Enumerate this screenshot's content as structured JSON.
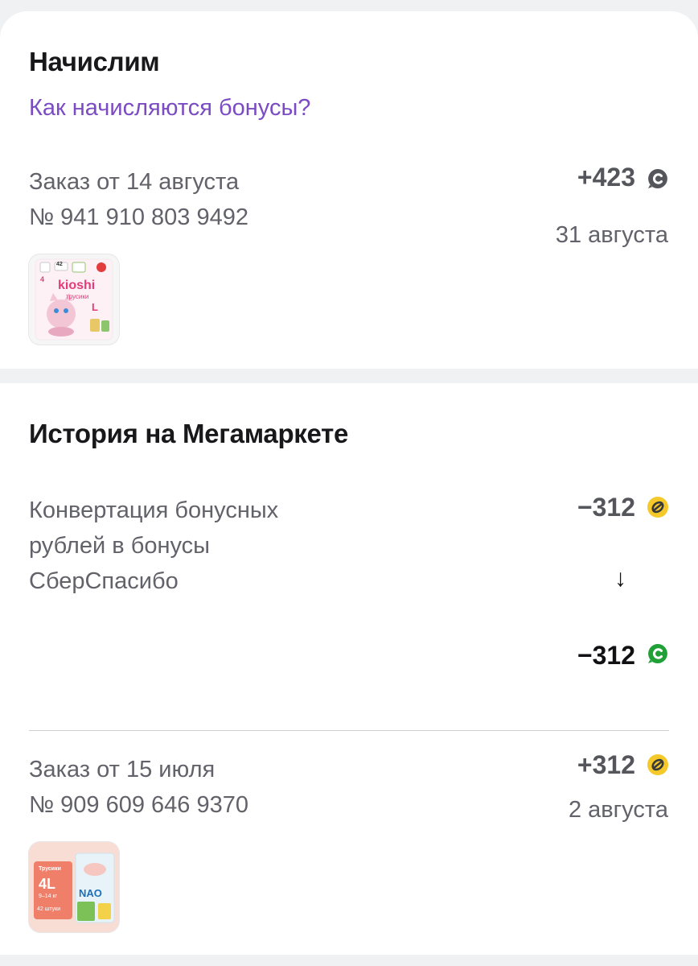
{
  "accrual": {
    "title": "Начислим",
    "how_link": "Как начисляются бонусы?",
    "order": {
      "title": "Заказ от 14 августа",
      "number": "№ 941 910 803 9492",
      "amount": "+423",
      "date": "31 августа",
      "product_label": "kioshi",
      "product_sub": "трусики",
      "product_size": "4",
      "product_count": "42",
      "product_letter": "L",
      "coin_icon": "sberspasibo-coin-grey-icon"
    }
  },
  "history": {
    "title": "История на Мегамаркете",
    "conversion": {
      "title_line1": "Конвертация бонусных",
      "title_line2": "рублей в бонусы",
      "title_line3": "СберСпасибо",
      "amount_from": "−312",
      "arrow": "↓",
      "amount_to": "−312",
      "coin_from_icon": "megamarket-bonus-coin-icon",
      "coin_to_icon": "sberspasibo-coin-green-icon"
    },
    "order": {
      "title": "Заказ от 15 июля",
      "number": "№ 909 609 646 9370",
      "amount": "+312",
      "date": "2 августа",
      "product_size": "4L",
      "product_caption": "Трусики",
      "product_weight": "9–14 кг",
      "product_count": "42 штуки",
      "product_brand": "NAO",
      "coin_icon": "megamarket-bonus-coin-icon"
    }
  },
  "colors": {
    "link": "#7b4bc4",
    "coin_yellow": "#f6c92b",
    "coin_green": "#21a038",
    "coin_grey": "#55555c"
  }
}
